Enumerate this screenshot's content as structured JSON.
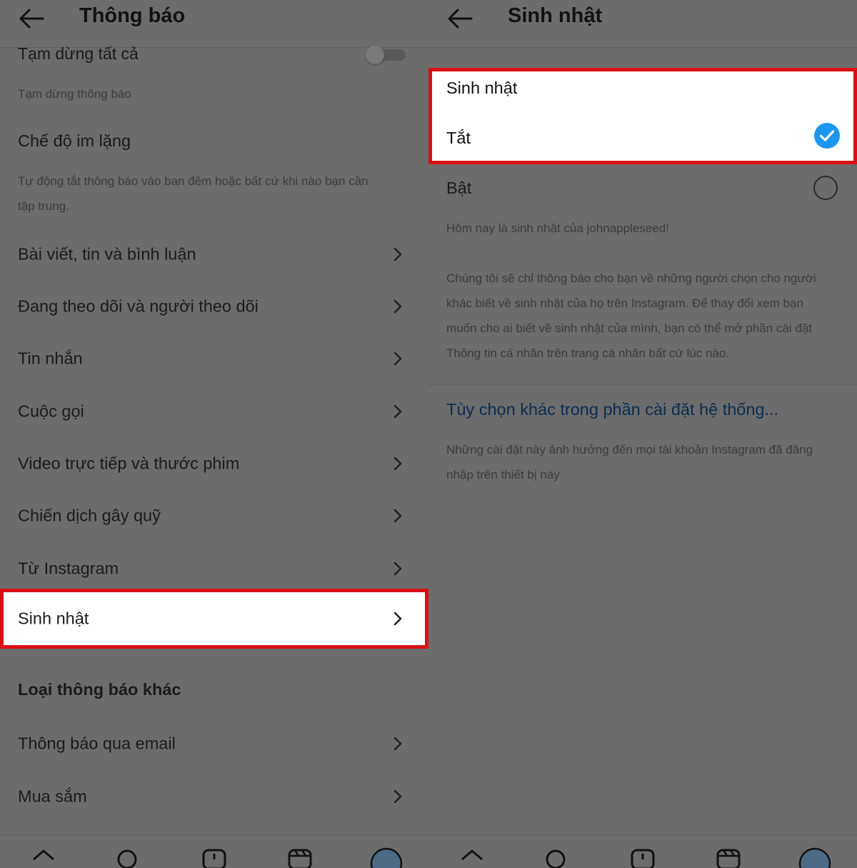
{
  "left": {
    "header": {
      "title": "Thông báo"
    },
    "pause_all": {
      "label": "Tạm dừng tất cả",
      "caption": "Tạm dừng thông báo",
      "enabled": false
    },
    "quiet_mode": {
      "label": "Chế độ im lặng",
      "description_line1": "Tự động tắt thông báo vào ban đêm hoặc bất cứ khi nào bạn cần",
      "description_line2": "tập trung."
    },
    "menu": [
      {
        "label": "Bài viết, tin và bình luận"
      },
      {
        "label": "Đang theo dõi và người theo dõi"
      },
      {
        "label": "Tin nhắn"
      },
      {
        "label": "Cuộc gọi"
      },
      {
        "label": "Video trực tiếp và thước phim"
      },
      {
        "label": "Chiến dịch gây quỹ"
      },
      {
        "label": "Từ Instagram"
      }
    ],
    "highlighted_item": {
      "label": "Sinh nhật"
    },
    "other_group": {
      "title": "Loại thông báo khác",
      "items": [
        {
          "label": "Thông báo qua email"
        },
        {
          "label": "Mua sắm"
        }
      ]
    }
  },
  "right": {
    "header": {
      "title": "Sinh nhật"
    },
    "section_caption": "Sinh nhật",
    "options": [
      {
        "label": "Tắt",
        "selected": true
      },
      {
        "label": "Bật",
        "selected": false
      }
    ],
    "example_text": "Hôm nay là sinh nhật của johnappleseed!",
    "explanation_lines": [
      "Chúng tôi sẽ chỉ thông báo cho bạn về những người chọn cho người",
      "khác biết về sinh nhật của họ trên Instagram. Để thay đổi xem bạn",
      "muốn cho ai biết về sinh nhật của mình, bạn có thể mở phần cài đặt",
      "Thông tin cá nhân trên trang cá nhân bất cứ lúc nào."
    ],
    "system_settings_link": "Tùy chọn khác trong phần cài đặt hệ thống...",
    "system_settings_note_lines": [
      "Những cài đặt này ảnh hưởng đến mọi tài khoản Instagram đã đăng",
      "nhập trên thiết bị này"
    ]
  },
  "icons": {
    "back": "arrow-left-icon",
    "chevron": "chevron-right-icon",
    "check": "checkmark-circle-icon",
    "nav": [
      "home-icon",
      "search-icon",
      "create-icon",
      "reels-icon",
      "profile-icon"
    ]
  },
  "colors": {
    "highlight_border": "#d90f16",
    "check_blue": "#1d96f0",
    "link": "#0d2d52"
  }
}
